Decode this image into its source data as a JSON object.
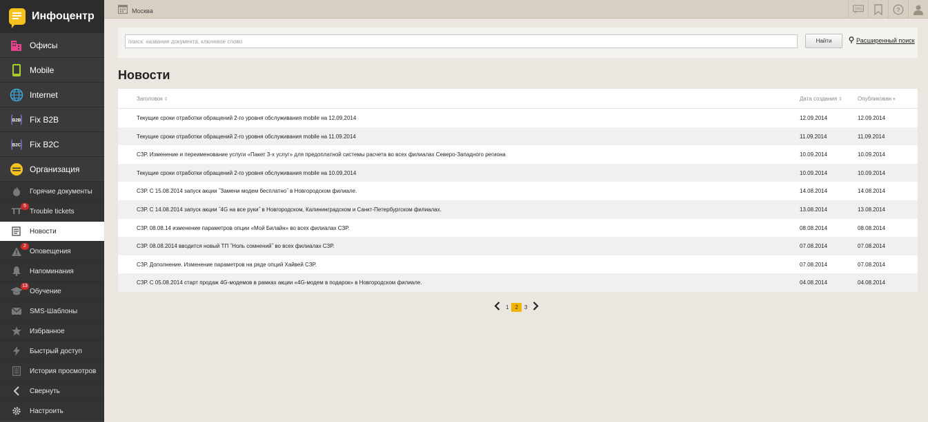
{
  "app": {
    "title": "Инфоцентр"
  },
  "sidebar": {
    "big_items": [
      {
        "label": "Офисы"
      },
      {
        "label": "Mobile"
      },
      {
        "label": "Internet"
      },
      {
        "label": "Fix B2B"
      },
      {
        "label": "Fix B2C"
      },
      {
        "label": "Организация"
      }
    ],
    "small_items": [
      {
        "label": "Горячие документы"
      },
      {
        "label": "Trouble tickets",
        "badge": "5"
      },
      {
        "label": "Новости"
      },
      {
        "label": "Оповещения",
        "badge": "2"
      },
      {
        "label": "Напоминания"
      },
      {
        "label": "Обучение",
        "badge": "13"
      },
      {
        "label": "SMS-Шаблоны"
      },
      {
        "label": "Избранное"
      },
      {
        "label": "Быстрый доступ"
      },
      {
        "label": "История просмотров"
      },
      {
        "label": "Свернуть"
      },
      {
        "label": "Настроить"
      }
    ]
  },
  "topbar": {
    "city": "Москва"
  },
  "search": {
    "placeholder": "поиск: название документа, ключевое слово",
    "button": "Найти",
    "advanced": "Расширенный поиск"
  },
  "page": {
    "title": "Новости"
  },
  "table": {
    "headers": {
      "title": "Заголовок",
      "date": "Дата создания",
      "published": "Опубликован"
    },
    "rows": [
      {
        "title": "Текущие сроки отработки обращений 2-го уровня обслуживания mobile на 12.09.2014",
        "date": "12.09.2014",
        "published": "12.09.2014"
      },
      {
        "title": "Текущие сроки отработки обращений 2-го уровня обслуживания mobile на 11.09.2014",
        "date": "11.09.2014",
        "published": "11.09.2014"
      },
      {
        "title": "СЗР. Изменение и переименование услуги «Пакет 3-х услуг» для предоплатной системы расчета во всех филиалах Северо-Западного региона",
        "date": "10.09.2014",
        "published": "10.09.2014"
      },
      {
        "title": "Текущие сроки отработки обращений 2-го уровня обслуживания mobile на 10.09.2014",
        "date": "10.09.2014",
        "published": "10.09.2014"
      },
      {
        "title": "СЗР. С 15.08.2014 запуск акции ˝Замени модем бесплатно˝ в Новгородском филиале.",
        "date": "14.08.2014",
        "published": "14.08.2014"
      },
      {
        "title": "СЗР. С 14.08.2014 запуск акции ˝4G на все руки˝ в Новгородском, Калининградском и Санкт-Петербургском филиалах.",
        "date": "13.08.2014",
        "published": "13.08.2014"
      },
      {
        "title": "СЗР. 08.08.14 изменение параметров опции «Мой Билайн» во всех филиалах СЗР.",
        "date": "08.08.2014",
        "published": "08.08.2014"
      },
      {
        "title": "СЗР. 08.08.2014 вводится новый ТП ˝Ноль сомнений˝ во всех филиалах СЗР.",
        "date": "07.08.2014",
        "published": "07.08.2014"
      },
      {
        "title": "СЗР. Дополнение. Изменение параметров на ряде опций Хайвей СЗР.",
        "date": "07.08.2014",
        "published": "07.08.2014"
      },
      {
        "title": "СЗР. С 05.08.2014 старт продаж 4G-модемов в рамках акции «4G-модем в подарок» в Новгородском филиале.",
        "date": "04.08.2014",
        "published": "04.08.2014"
      }
    ]
  },
  "pagination": {
    "pages": [
      "1",
      "2",
      "3"
    ],
    "current": "2"
  },
  "colors": {
    "accent": "#f0b400",
    "sidebar": "#3a3a3a",
    "badge": "#d12a2a"
  }
}
